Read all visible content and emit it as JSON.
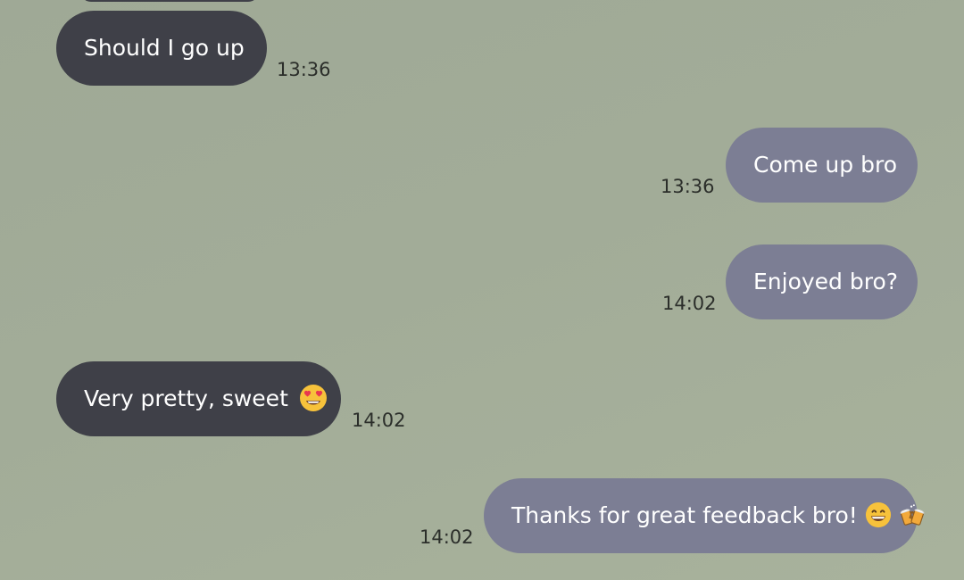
{
  "messages": [
    {
      "direction": "incoming",
      "text": "Should I go up",
      "time": "13:36"
    },
    {
      "direction": "outgoing",
      "text": "Come up bro",
      "time": "13:36"
    },
    {
      "direction": "outgoing",
      "text": "Enjoyed bro?",
      "time": "14:02"
    },
    {
      "direction": "incoming",
      "text": "Very pretty, sweet",
      "emoji": "heart-eyes-emoji",
      "time": "14:02"
    },
    {
      "direction": "outgoing",
      "text": "Thanks for great feedback bro!",
      "emoji": [
        "grinning-emoji",
        "beer-mugs-emoji"
      ],
      "time": "14:02"
    }
  ],
  "colors": {
    "incoming_bubble": "#3f4048",
    "outgoing_bubble": "#7c7e94",
    "background": "#a2ac98",
    "timestamp": "#2b2e2a"
  }
}
